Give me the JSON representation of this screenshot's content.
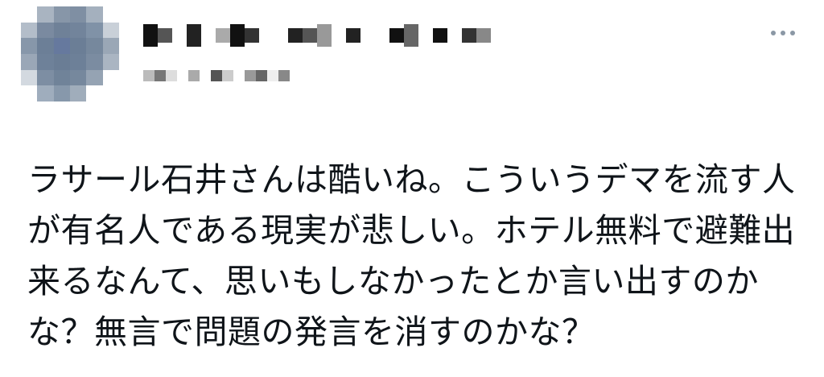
{
  "tweet": {
    "lines": [
      "ラサール石井さんは酷いね。こういうデマを流す人",
      "が有名人である現実が悲しい。ホテル無料で避難出",
      "来るなんて、思いもしなかったとか言い出すのか",
      "な？無言で問題の発言を消すのかな？"
    ]
  },
  "avatar": {
    "icon": "pixelated-avatar",
    "tiles": [
      "#ffffff",
      "#a9b4c1",
      "#8796a8",
      "#7f8fa3",
      "#a4b0be",
      "#ffffff",
      "#b3bdc9",
      "#7a8aa0",
      "#6f8198",
      "#72849b",
      "#8092a7",
      "#c9d0d8",
      "#8797aa",
      "#6c7f97",
      "#66799e",
      "#6b7e96",
      "#76889d",
      "#9aa7b6",
      "#9aa7b7",
      "#6e8199",
      "#6a7d95",
      "#6d8098",
      "#7b8ca1",
      "#aab5c2",
      "#d3d9e0",
      "#7d8ea3",
      "#708399",
      "#76889d",
      "#95a3b3",
      "#ffffff",
      "#ffffff",
      "#9fadbd",
      "#8798ab",
      "#a0adbb",
      "#ffffff",
      "#ffffff"
    ]
  },
  "name_pixels": [
    "#111",
    "#555",
    "#fff",
    "#222",
    "#fff",
    "#aaa",
    "#111",
    "#333",
    "#fff",
    "#fff",
    "#222",
    "#555",
    "#999",
    "#fff",
    "#222",
    "#fff",
    "#fff",
    "#111",
    "#666",
    "#fff",
    "#111",
    "#fff",
    "#333",
    "#888"
  ],
  "handle_pixels": [
    "#bbb",
    "#777",
    "#ddd",
    "#fff",
    "#aaa",
    "#fff",
    "#555",
    "#ccc",
    "#fff",
    "#999",
    "#666",
    "#eee",
    "#888"
  ]
}
